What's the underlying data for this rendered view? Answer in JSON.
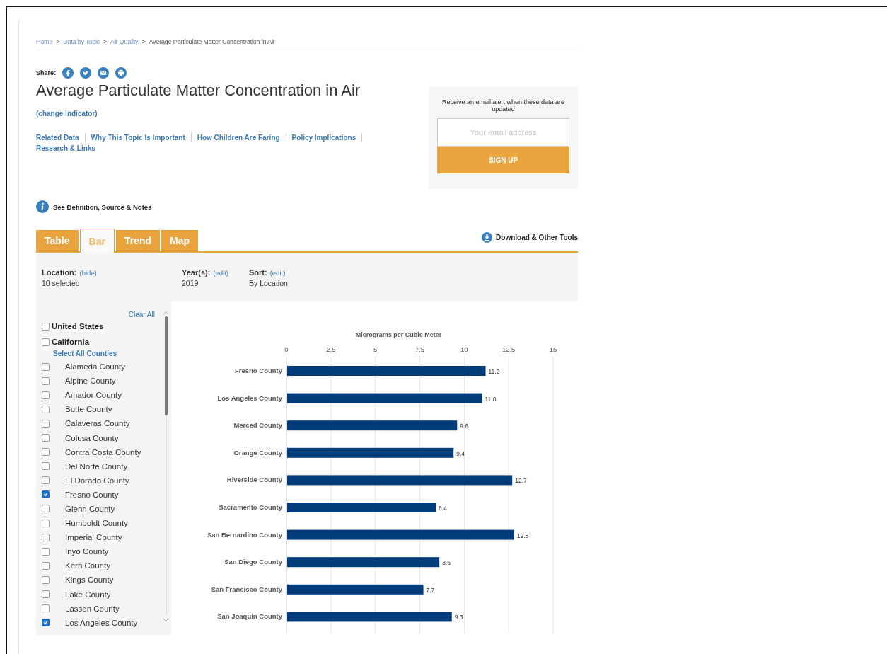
{
  "breadcrumb": [
    {
      "label": "Home",
      "link": true
    },
    {
      "label": "Data by Topic",
      "link": true
    },
    {
      "label": "Air Quality",
      "link": true
    },
    {
      "label": "Average Particulate Matter Concentration in Air",
      "link": false
    }
  ],
  "breadcrumb_separator": ">",
  "share": {
    "label": "Share:"
  },
  "title": "Average Particulate Matter Concentration in Air",
  "change_indicator": "(change indicator)",
  "topic_links": [
    "Related Data",
    "Why This Topic Is Important",
    "How Children Are Faring",
    "Policy Implications",
    "Research & Links"
  ],
  "alert_box": {
    "text": "Receive an email alert when these data are updated",
    "email": {
      "placeholder": "Your email address"
    },
    "button": "SIGN UP"
  },
  "definition_link": "See Definition, Source & Notes",
  "tabs": [
    {
      "label": "Table",
      "selected": false
    },
    {
      "label": "Bar",
      "selected": true
    },
    {
      "label": "Trend",
      "selected": false
    },
    {
      "label": "Map",
      "selected": false
    }
  ],
  "download": "Download & Other Tools",
  "filters": [
    {
      "label": "Location:",
      "action": "(hide)",
      "value": "10 selected"
    },
    {
      "label": "Year(s):",
      "action": "(edit)",
      "value": "2019"
    },
    {
      "label": "Sort:",
      "action": "(edit)",
      "value": "By Location"
    }
  ],
  "location_panel": {
    "clear_all": "Clear All",
    "select_all": "Select All Counties",
    "top_items": [
      {
        "label": "United States",
        "checked": false
      },
      {
        "label": "California",
        "checked": false
      }
    ],
    "counties": [
      {
        "label": "Alameda County",
        "checked": false
      },
      {
        "label": "Alpine County",
        "checked": false
      },
      {
        "label": "Amador County",
        "checked": false
      },
      {
        "label": "Butte County",
        "checked": false
      },
      {
        "label": "Calaveras County",
        "checked": false
      },
      {
        "label": "Colusa County",
        "checked": false
      },
      {
        "label": "Contra Costa County",
        "checked": false
      },
      {
        "label": "Del Norte County",
        "checked": false
      },
      {
        "label": "El Dorado County",
        "checked": false
      },
      {
        "label": "Fresno County",
        "checked": true
      },
      {
        "label": "Glenn County",
        "checked": false
      },
      {
        "label": "Humboldt County",
        "checked": false
      },
      {
        "label": "Imperial County",
        "checked": false
      },
      {
        "label": "Inyo County",
        "checked": false
      },
      {
        "label": "Kern County",
        "checked": false
      },
      {
        "label": "Kings County",
        "checked": false
      },
      {
        "label": "Lake County",
        "checked": false
      },
      {
        "label": "Lassen County",
        "checked": false
      },
      {
        "label": "Los Angeles County",
        "checked": true
      }
    ]
  },
  "chart": {
    "chart_data": {
      "type": "bar",
      "orientation": "horizontal",
      "xlabel": "Micrograms per Cubic Meter",
      "categories": [
        "Fresno County",
        "Los Angeles County",
        "Merced County",
        "Orange County",
        "Riverside County",
        "Sacramento County",
        "San Bernardino County",
        "San Diego County",
        "San Francisco County",
        "San Joaquin County"
      ],
      "series": [
        {
          "color": "#003b7a",
          "values": [
            11.2,
            11.0,
            9.6,
            9.4,
            12.7,
            8.4,
            12.8,
            8.6,
            7.7,
            9.3
          ]
        }
      ],
      "xlim": [
        0,
        15
      ],
      "xticks": [
        0,
        2.5,
        5,
        7.5,
        10,
        12.5,
        15
      ],
      "grid": true,
      "value_labels": [
        "11.2",
        "11.0",
        "9.6",
        "9.4",
        "12.7",
        "8.4",
        "12.8",
        "8.6",
        "7.7",
        "9.3"
      ]
    }
  }
}
